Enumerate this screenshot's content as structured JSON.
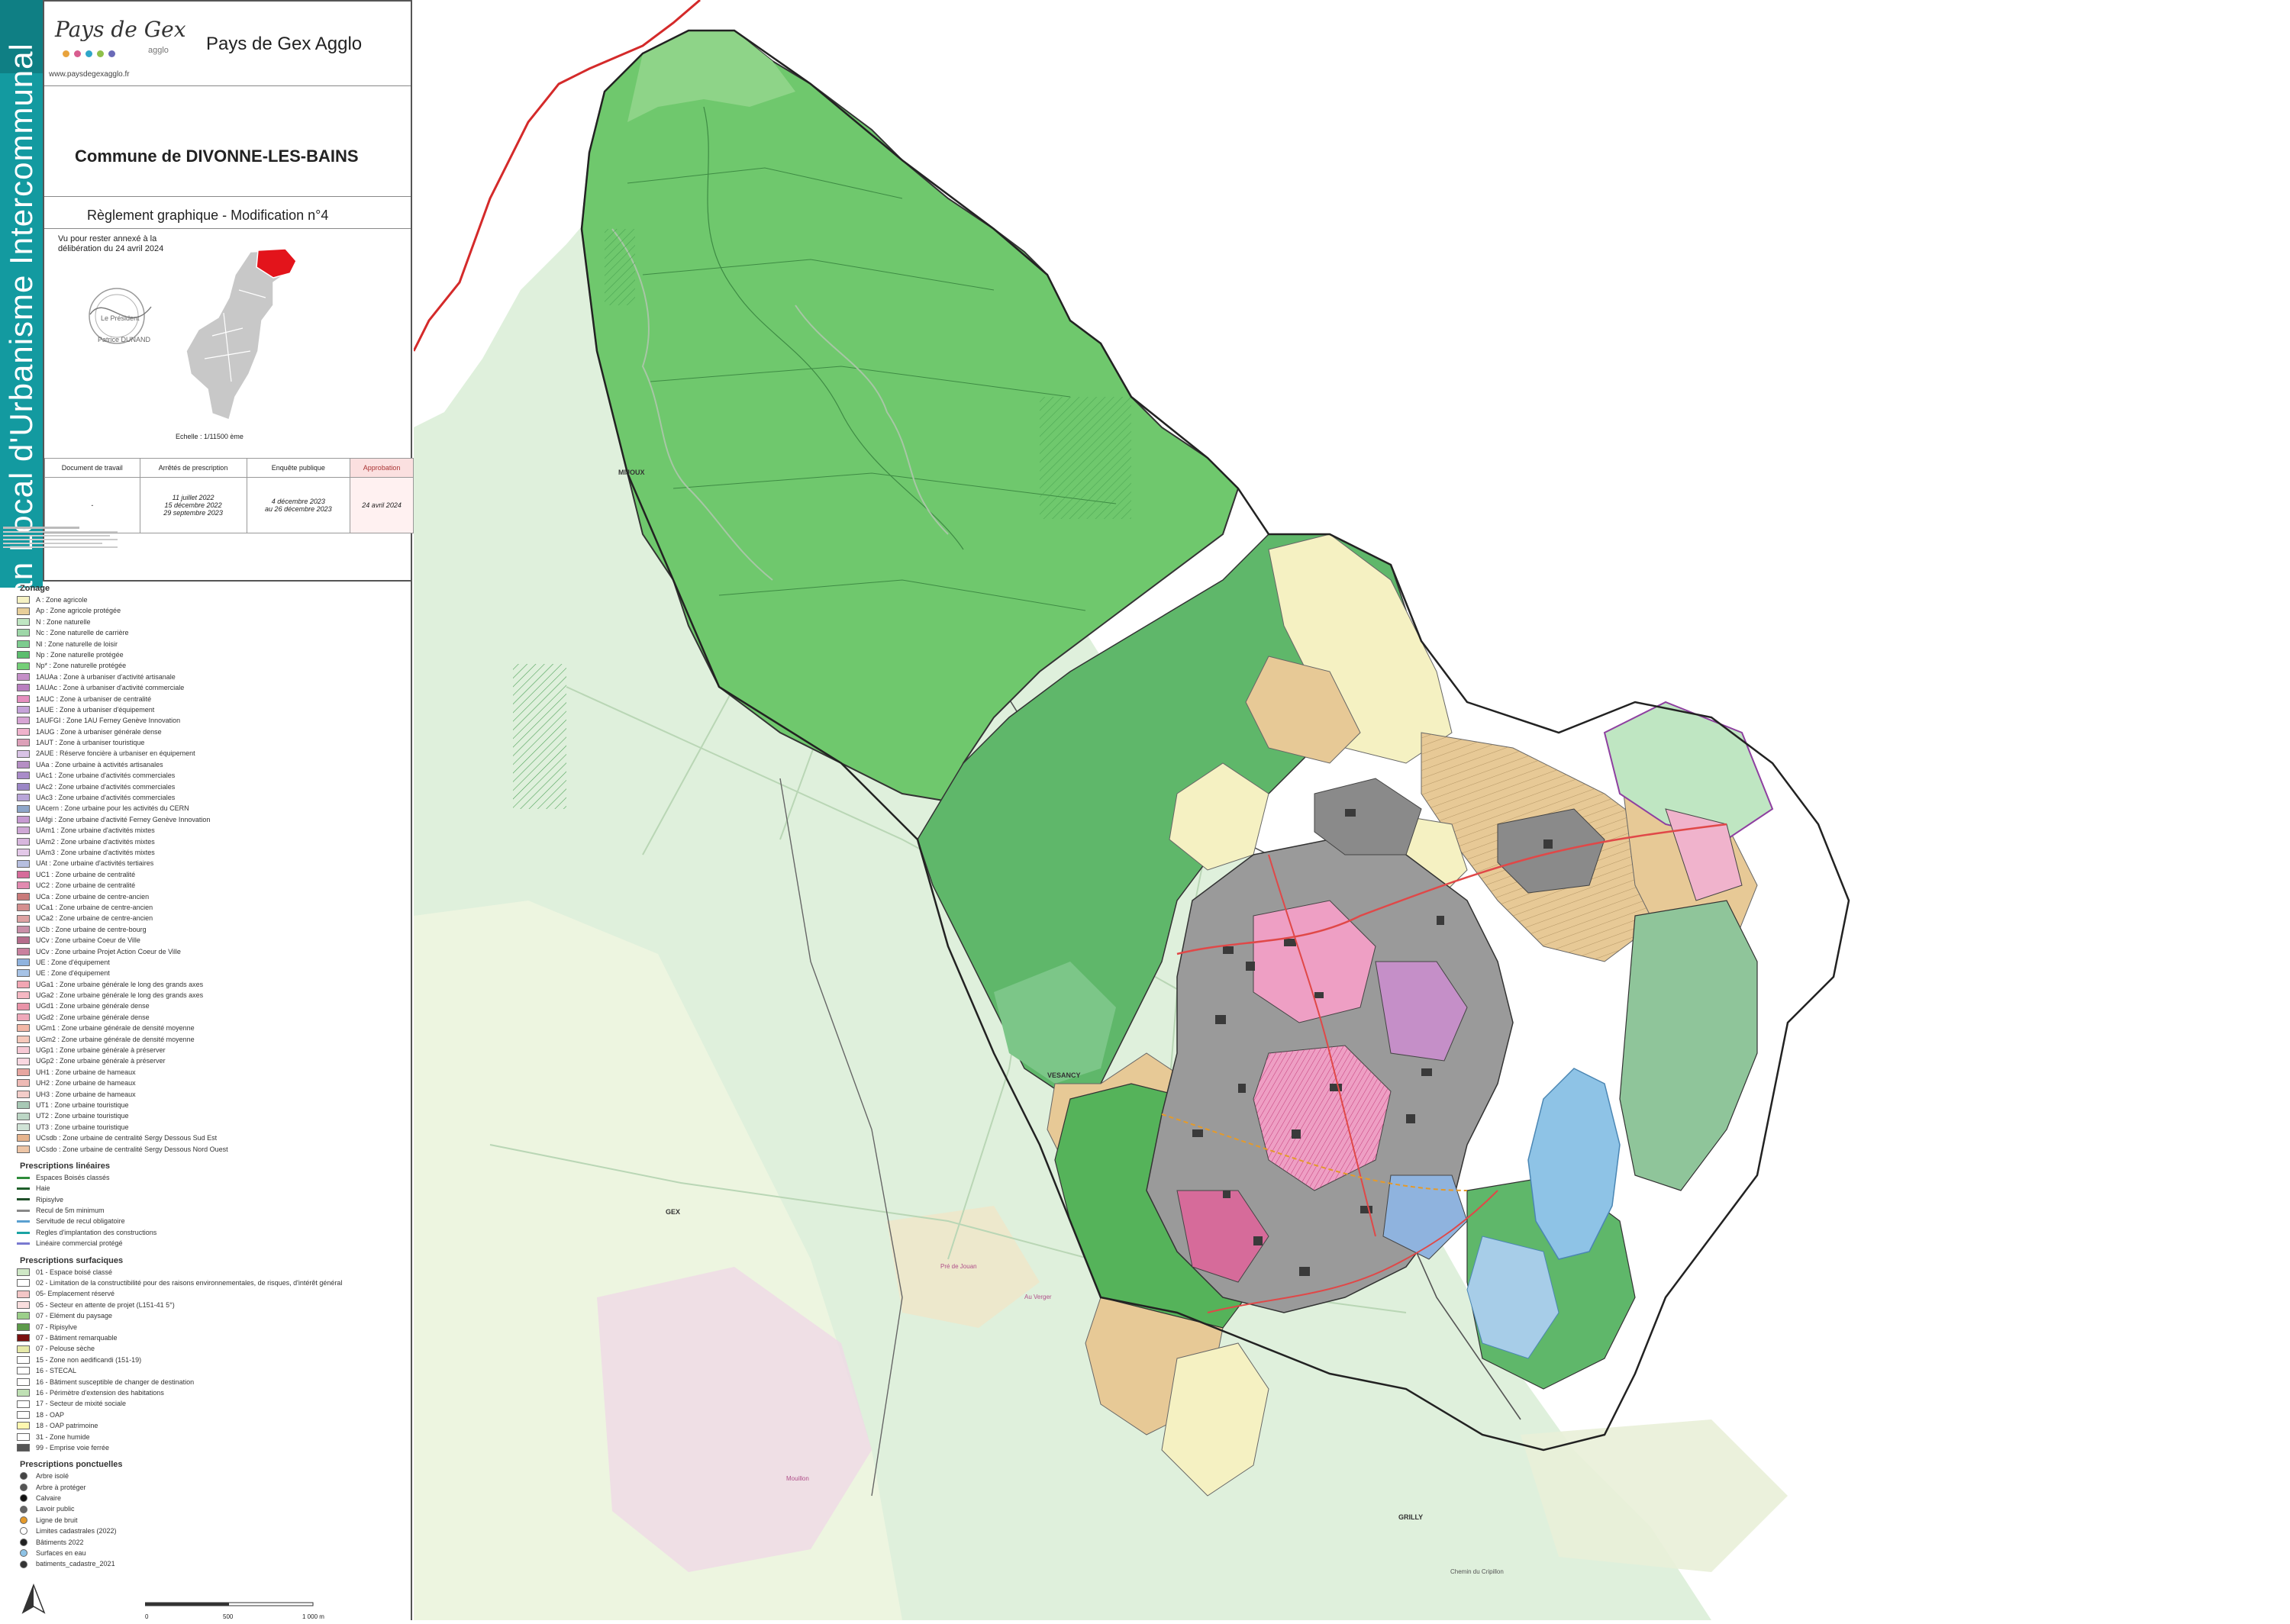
{
  "header": {
    "vertical_title": "Plan Local d'Urbanisme Intercommunal",
    "logo_text": "Pays de Gex",
    "logo_sub": "agglo",
    "agglo_name": "Pays de Gex Agglo",
    "website": "www.paysdegexagglo.fr",
    "commune": "Commune de DIVONNE-LES-BAINS",
    "reglement": "Règlement graphique -  Modification  n°4",
    "vu": "Vu pour rester annexé à la délibération du 24 avril 2024",
    "president_label": "Le Président",
    "president_name": "Patrice DUNAND",
    "echelle": "Echelle : 1/11500 ème",
    "colors": {
      "band": "#139aa0",
      "commune_highlight": "#e3141b"
    }
  },
  "procedure": {
    "columns": [
      "Document de travail",
      "Arrêtés de prescription",
      "Enquête publique",
      "Approbation"
    ],
    "values": [
      "-",
      "11 juillet 2022\n15 décembre 2022\n29 septembre 2023",
      "4 décembre 2023\nau 26 décembre 2023",
      "24 avril 2024"
    ]
  },
  "legend": {
    "zonage_title": "Zonage",
    "zonage": [
      {
        "label": "A : Zone agricole",
        "color": "#f6f2c4"
      },
      {
        "label": "Ap : Zone agricole protégée",
        "color": "#e8cf9a"
      },
      {
        "label": "N : Zone naturelle",
        "color": "#bfe6c2"
      },
      {
        "label": "Nc : Zone naturelle de carrière",
        "color": "#9ed7a8"
      },
      {
        "label": "Nl : Zone naturelle de loisir",
        "color": "#7dcc8f"
      },
      {
        "label": "Np : Zone naturelle protégée",
        "color": "#5cbd6e"
      },
      {
        "label": "Np* : Zone naturelle protégée",
        "color": "#74cf78"
      },
      {
        "label": "1AUAa : Zone à urbaniser d'activité artisanale",
        "color": "#c58fc8"
      },
      {
        "label": "1AUAc : Zone à urbaniser d'activité commerciale",
        "color": "#b97fc0"
      },
      {
        "label": "1AUC : Zone à urbaniser de centralité",
        "color": "#e58fbf"
      },
      {
        "label": "1AUE : Zone à urbaniser d'équipement",
        "color": "#c5a3d9"
      },
      {
        "label": "1AUFGI : Zone 1AU Ferney Genève Innovation",
        "color": "#d7a5d4"
      },
      {
        "label": "1AUG : Zone à urbaniser générale dense",
        "color": "#f0b3cc"
      },
      {
        "label": "1AUT : Zone à urbaniser touristique",
        "color": "#dca0b8"
      },
      {
        "label": "2AUE : Réserve foncière à urbaniser en équipement",
        "color": "#d9c3e6"
      },
      {
        "label": "UAa : Zone urbaine à activités artisanales",
        "color": "#b58ec4"
      },
      {
        "label": "UAc1 : Zone urbaine d'activités commerciales",
        "color": "#a98bc9"
      },
      {
        "label": "UAc2 : Zone urbaine d'activités commerciales",
        "color": "#9b86c6"
      },
      {
        "label": "UAc3 : Zone urbaine d'activités commerciales",
        "color": "#b9a6d9"
      },
      {
        "label": "UAcern : Zone urbaine pour les activités du CERN",
        "color": "#8ea6c9"
      },
      {
        "label": "UAfgi : Zone urbaine d'activité Ferney Genève Innovation",
        "color": "#c79ad2"
      },
      {
        "label": "UAm1 : Zone urbaine d'activités mixtes",
        "color": "#cfa8d6"
      },
      {
        "label": "UAm2 : Zone urbaine d'activités mixtes",
        "color": "#d8b7de"
      },
      {
        "label": "UAm3 : Zone urbaine d'activités mixtes",
        "color": "#e3c8e8"
      },
      {
        "label": "UAt : Zone urbaine d'activités tertiaires",
        "color": "#b7bfe0"
      },
      {
        "label": "UC1 : Zone urbaine de centralité",
        "color": "#d66b9a"
      },
      {
        "label": "UC2 : Zone urbaine de centralité",
        "color": "#e28ab0"
      },
      {
        "label": "UCa : Zone urbaine de centre-ancien",
        "color": "#c97a7a"
      },
      {
        "label": "UCa1 : Zone urbaine de centre-ancien",
        "color": "#d48f8f"
      },
      {
        "label": "UCa2 : Zone urbaine de centre-ancien",
        "color": "#dea3a3"
      },
      {
        "label": "UCb : Zone urbaine de centre-bourg",
        "color": "#c98fa8"
      },
      {
        "label": "UCv : Zone urbaine Coeur de Ville",
        "color": "#b56d8c"
      },
      {
        "label": "UCv : Zone urbaine Projet Action Coeur de Ville",
        "color": "#c9819e"
      },
      {
        "label": "UE : Zone d'équipement",
        "color": "#8fb3de"
      },
      {
        "label": "UE : Zone d'équipement",
        "color": "#a7c3e6"
      },
      {
        "label": "UGa1 : Zone urbaine générale le long des grands axes",
        "color": "#f2a6b3"
      },
      {
        "label": "UGa2 : Zone urbaine générale le long des grands axes",
        "color": "#f5b8c3"
      },
      {
        "label": "UGd1 : Zone urbaine générale dense",
        "color": "#e993a8"
      },
      {
        "label": "UGd2 : Zone urbaine générale dense",
        "color": "#efa9ba"
      },
      {
        "label": "UGm1 : Zone urbaine générale de densité moyenne",
        "color": "#f3b7a6"
      },
      {
        "label": "UGm2 : Zone urbaine générale de densité moyenne",
        "color": "#f6c8ba"
      },
      {
        "label": "UGp1 : Zone urbaine générale à préserver",
        "color": "#f7c9d5"
      },
      {
        "label": "UGp2 : Zone urbaine générale à préserver",
        "color": "#fad8e1"
      },
      {
        "label": "UH1 : Zone urbaine de hameaux",
        "color": "#e7a6a0"
      },
      {
        "label": "UH2 : Zone urbaine de hameaux",
        "color": "#eebab5"
      },
      {
        "label": "UH3 : Zone urbaine de hameaux",
        "color": "#f4cdc9"
      },
      {
        "label": "UT1 : Zone urbaine touristique",
        "color": "#a8c8b5"
      },
      {
        "label": "UT2 : Zone urbaine touristique",
        "color": "#bcd6c5"
      },
      {
        "label": "UT3 : Zone urbaine touristique",
        "color": "#d0e3d6"
      },
      {
        "label": "UCsdb : Zone urbaine de centralité Sergy Dessous Sud Est",
        "color": "#e6b48e"
      },
      {
        "label": "UCsdo : Zone urbaine de centralité Sergy Dessous Nord Ouest",
        "color": "#edc5a6"
      }
    ],
    "lineaires_title": "Prescriptions linéaires",
    "lineaires": [
      {
        "label": "Espaces Boisés classés",
        "color": "#2e8b3a"
      },
      {
        "label": "Haie",
        "color": "#1f5f2a"
      },
      {
        "label": "Ripisylve",
        "color": "#1f4f2a"
      },
      {
        "label": "Recul de 5m minimum",
        "color": "#888888"
      },
      {
        "label": "Servitude de recul obligatoire",
        "color": "#5aa0d0"
      },
      {
        "label": "Regles d'implantation des constructions",
        "color": "#1aa3a3"
      },
      {
        "label": "Linéaire commercial protégé",
        "color": "#7a7ad0"
      }
    ],
    "surfaciques_title": "Prescriptions surfaciques",
    "surfaciques": [
      {
        "label": "01 - Espace boisé classé",
        "color": "#cfe8c6"
      },
      {
        "label": "02 - Limitation de la constructibilité pour des raisons environnementales, de risques, d'intérêt général",
        "color": "#ffffff"
      },
      {
        "label": "05- Emplacement réservé",
        "color": "#f3c6c6"
      },
      {
        "label": "05 - Secteur en attente de projet (L151-41 5°)",
        "color": "#f9dede"
      },
      {
        "label": "07 - Elément du paysage",
        "color": "#9ccf8a"
      },
      {
        "label": "07 - Ripisylve",
        "color": "#5d9a4a"
      },
      {
        "label": "07 - Bâtiment remarquable",
        "color": "#7a1010"
      },
      {
        "label": "07 - Pelouse sèche",
        "color": "#e6e9a8"
      },
      {
        "label": "15 - Zone non aedificandi (151-19)",
        "color": "#ffffff"
      },
      {
        "label": "16 - STECAL",
        "color": "#ffffff"
      },
      {
        "label": "16 - Bâtiment susceptible de changer de destination",
        "color": "#ffffff"
      },
      {
        "label": "16 - Périmètre d'extension des habitations",
        "color": "#bfe0b4"
      },
      {
        "label": "17 - Secteur de mixité sociale",
        "color": "#ffffff"
      },
      {
        "label": "18 - OAP",
        "color": "#ffffff"
      },
      {
        "label": "18 - OAP patrimoine",
        "color": "#fff7b0"
      },
      {
        "label": "31 - Zone humide",
        "color": "#ffffff"
      },
      {
        "label": "99 - Emprise voie ferrée",
        "color": "#555555"
      }
    ],
    "ponctuelles_title": "Prescriptions ponctuelles",
    "ponctuelles": [
      {
        "label": "Arbre isolé",
        "color": "#444444"
      },
      {
        "label": "Arbre à protéger",
        "color": "#555555"
      },
      {
        "label": "Calvaire",
        "color": "#111111"
      },
      {
        "label": "Lavoir public",
        "color": "#666666"
      },
      {
        "label": "Ligne de bruit",
        "color": "#e59a2a"
      },
      {
        "label": "Limites cadastrales (2022)",
        "color": "#ffffff"
      },
      {
        "label": "Bâtiments 2022",
        "color": "#222222"
      },
      {
        "label": "Surfaces en eau",
        "color": "#8ec3e6"
      },
      {
        "label": "batiments_cadastre_2021",
        "color": "#333333"
      }
    ]
  },
  "scale_bar": {
    "ticks": [
      "0",
      "500",
      "1 000 m"
    ]
  },
  "map": {
    "place_labels": [
      "MIJOUX",
      "VESANCY",
      "GEX",
      "GRILLY",
      "Pré de Jouan",
      "Au Verger",
      "Chemin du Cripillon",
      "Mouillon"
    ],
    "colors": {
      "forest": "#6fc86d",
      "forest_dark": "#55b35a",
      "natural": "#9bd39d",
      "agri": "#f5f1c2",
      "agri_prot": "#e7c996",
      "urban_grey": "#8a8a8a",
      "urban_pink": "#ee9fc4",
      "lake": "#8ec3e6",
      "boundary_ch": "#d42a2a"
    }
  }
}
